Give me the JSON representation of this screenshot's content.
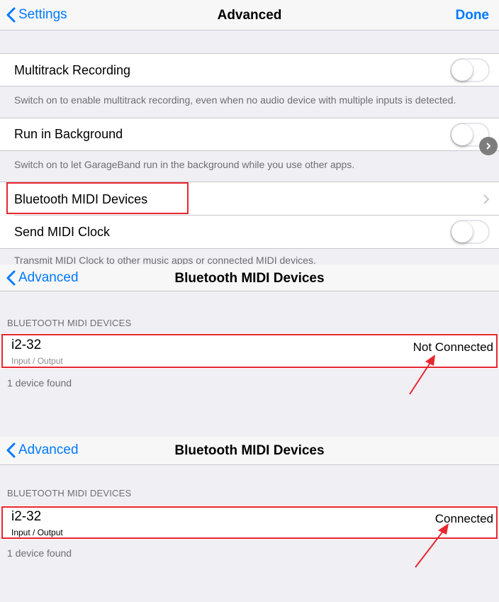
{
  "advanced_screen": {
    "nav": {
      "back_label": "Settings",
      "title": "Advanced",
      "done_label": "Done"
    },
    "rows": [
      {
        "label": "Multitrack Recording",
        "footer": "Switch on to enable multitrack recording, even when no audio device with multiple inputs is detected.",
        "toggle": "off"
      },
      {
        "label": "Run in Background",
        "footer": "Switch on to let GarageBand run in the background while you use other apps.",
        "toggle": "off"
      },
      {
        "label": "Bluetooth MIDI Devices",
        "accessory": "chevron"
      },
      {
        "label": "Send MIDI Clock",
        "footer": "Transmit MIDI Clock to other music apps or connected MIDI devices.",
        "toggle": "off"
      }
    ]
  },
  "bt_screens": [
    {
      "nav": {
        "back_label": "Advanced",
        "title": "Bluetooth MIDI Devices"
      },
      "section_header": "BLUETOOTH MIDI DEVICES",
      "device": {
        "name": "i2-32",
        "subtitle": "Input / Output",
        "status": "Not Connected"
      },
      "footer": "1 device found"
    },
    {
      "nav": {
        "back_label": "Advanced",
        "title": "Bluetooth MIDI Devices"
      },
      "section_header": "BLUETOOTH MIDI DEVICES",
      "device": {
        "name": "i2-32",
        "subtitle": "Input / Output",
        "status": "Connected"
      },
      "footer": "1 device found"
    }
  ],
  "colors": {
    "ios_blue": "#007aff",
    "highlight_red": "#e8262e",
    "group_bg": "#efeff4"
  }
}
